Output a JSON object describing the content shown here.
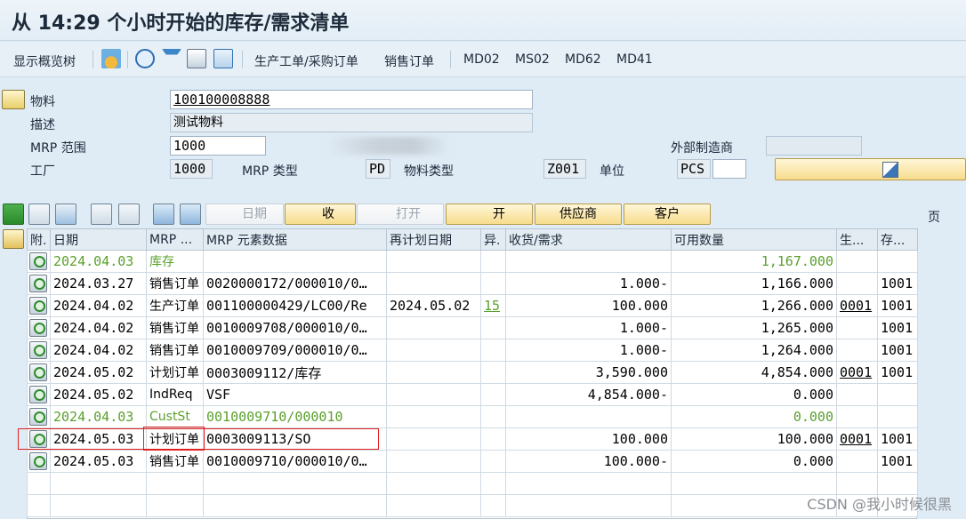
{
  "title": "从 14:29 个小时开始的库存/需求清单",
  "toolbar": {
    "show_tree": "显示概览树",
    "prod_purchase_orders": "生产工单/采购订单",
    "sales_orders": "销售订单",
    "md02": "MD02",
    "ms02": "MS02",
    "md62": "MD62",
    "md41": "MD41"
  },
  "form": {
    "material_label": "物料",
    "material_value": "100100008888",
    "desc_label": "描述",
    "desc_value": "测试物料",
    "mrp_area_label": "MRP 范围",
    "mrp_area_value": "1000",
    "plant_label": "工厂",
    "plant_value": "1000",
    "mrp_type_label": "MRP 类型",
    "mrp_type_value": "PD",
    "material_type_label": "物料类型",
    "material_type_value": "Z001",
    "unit_label": "单位",
    "unit_value": "PCS",
    "ext_mfr_label": "外部制造商"
  },
  "grid_toolbar": {
    "date": "日期",
    "receive": "收",
    "open": "打开",
    "open2": "开",
    "supplier": "供应商",
    "customer": "客户",
    "page": "页"
  },
  "table": {
    "headers": [
      "附.",
      "日期",
      "MRP ...",
      "MRP 元素数据",
      "再计划日期",
      "异.",
      "收货/需求",
      "可用数量",
      "生...",
      "存..."
    ],
    "rows": [
      {
        "date": "2024.04.03",
        "mrp": "库存",
        "elem": "",
        "resched": "",
        "exc": "",
        "qty": "",
        "avail": "1,167.000",
        "prod": "",
        "stor": "",
        "green": true
      },
      {
        "date": "2024.03.27",
        "mrp": "销售订单",
        "elem": "0020000172/000010/0…",
        "resched": "",
        "exc": "",
        "qty": "1.000-",
        "avail": "1,166.000",
        "prod": "",
        "stor": "1001"
      },
      {
        "date": "2024.04.02",
        "mrp": "生产订单",
        "elem": "001100000429/LC00/Re",
        "resched": "2024.05.02",
        "exc": "15",
        "qty": "100.000",
        "avail": "1,266.000",
        "prod": "0001",
        "stor": "1001"
      },
      {
        "date": "2024.04.02",
        "mrp": "销售订单",
        "elem": "0010009708/000010/0…",
        "resched": "",
        "exc": "",
        "qty": "1.000-",
        "avail": "1,265.000",
        "prod": "",
        "stor": "1001"
      },
      {
        "date": "2024.04.02",
        "mrp": "销售订单",
        "elem": "0010009709/000010/0…",
        "resched": "",
        "exc": "",
        "qty": "1.000-",
        "avail": "1,264.000",
        "prod": "",
        "stor": "1001"
      },
      {
        "date": "2024.05.02",
        "mrp": "计划订单",
        "elem": "0003009112/库存",
        "resched": "",
        "exc": "",
        "qty": "3,590.000",
        "avail": "4,854.000",
        "prod": "0001",
        "stor": "1001"
      },
      {
        "date": "2024.05.02",
        "mrp": "IndReq",
        "elem": "VSF",
        "resched": "",
        "exc": "",
        "qty": "4,854.000-",
        "avail": "0.000",
        "prod": "",
        "stor": ""
      },
      {
        "date": "2024.04.03",
        "mrp": "CustSt",
        "elem": "0010009710/000010",
        "resched": "",
        "exc": "",
        "qty": "",
        "avail": "0.000",
        "prod": "",
        "stor": "",
        "green": true
      },
      {
        "date": "2024.05.03",
        "mrp": "计划订单",
        "elem": "0003009113/SO",
        "resched": "",
        "exc": "",
        "qty": "100.000",
        "avail": "100.000",
        "prod": "0001",
        "stor": "1001"
      },
      {
        "date": "2024.05.03",
        "mrp": "销售订单",
        "elem": "0010009710/000010/0…",
        "resched": "",
        "exc": "",
        "qty": "100.000-",
        "avail": "0.000",
        "prod": "",
        "stor": "1001"
      }
    ]
  },
  "watermark": "CSDN @我小时候很黑"
}
